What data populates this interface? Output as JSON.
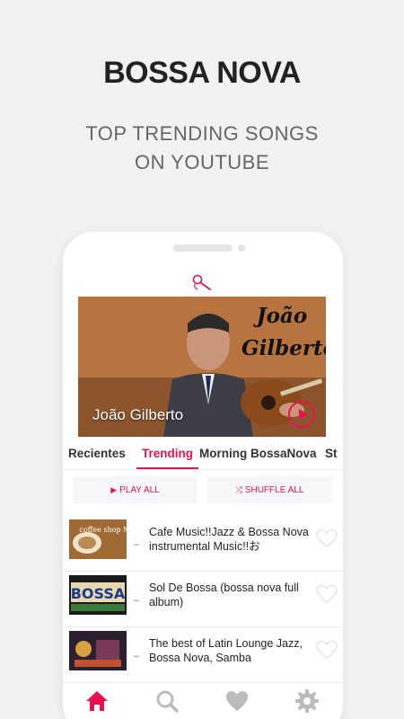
{
  "promo": {
    "headline": "BOSSA NOVA",
    "subline_1": "TOP TRENDING SONGS",
    "subline_2": "ON YOUTUBE"
  },
  "hero": {
    "art_line_1": "João",
    "art_line_2": "Gilberto",
    "caption": "João Gilberto"
  },
  "tabs": [
    {
      "label": "Recientes"
    },
    {
      "label": "Trending"
    },
    {
      "label": "Morning BossaNova"
    },
    {
      "label": "St"
    }
  ],
  "actions": {
    "play_all": "PLAY ALL",
    "shuffle_all": "SHUFFLE ALL"
  },
  "songs": [
    {
      "title": "Cafe Music!!Jazz & Bossa Nova instrumental Music!!お",
      "thumb_text": "coffee shop Music"
    },
    {
      "title": "Sol De Bossa (bossa nova full album)",
      "thumb_text": "BOSSA"
    },
    {
      "title": "The best of Latin Lounge Jazz, Bossa Nova, Samba",
      "thumb_text": ""
    }
  ],
  "colors": {
    "accent": "#e8124f",
    "background": "#f2f2f2"
  },
  "icons": {
    "mic": "microphone-icon",
    "home": "home-icon",
    "search": "search-icon",
    "favorites": "heart-icon",
    "settings": "gear-icon"
  }
}
